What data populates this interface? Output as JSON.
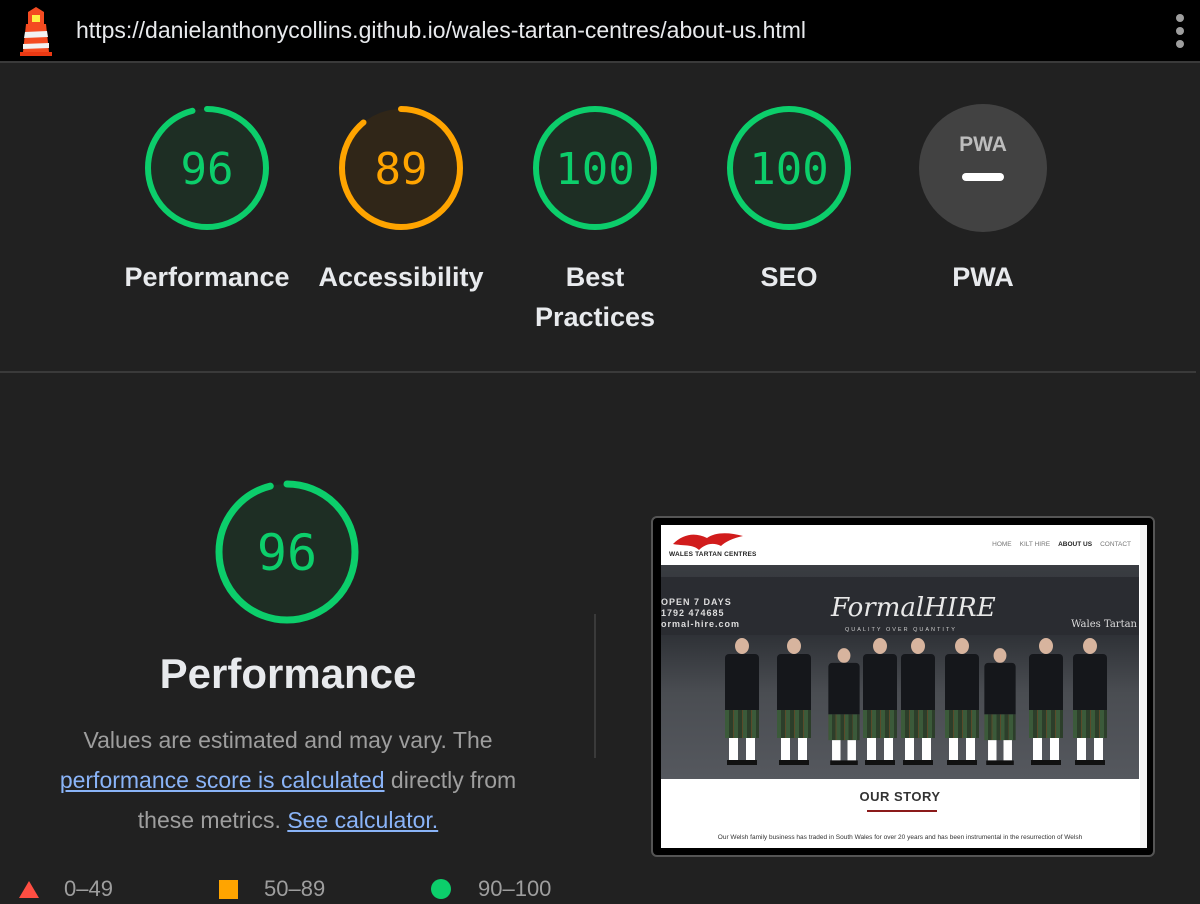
{
  "topbar": {
    "url": "https://danielanthonycollins.github.io/wales-tartan-centres/about-us.html",
    "logo_icon": "lighthouse-icon",
    "menu_icon": "kebab-menu-icon"
  },
  "gauges": [
    {
      "score": "96",
      "label": "Performance",
      "color": "#0cce6b",
      "fraction": 0.96
    },
    {
      "score": "89",
      "label": "Accessibility",
      "color": "#ffa400",
      "fraction": 0.89
    },
    {
      "score": "100",
      "label_line1": "Best",
      "label_line2": "Practices",
      "color": "#0cce6b",
      "fraction": 1.0
    },
    {
      "score": "100",
      "label": "SEO",
      "color": "#0cce6b",
      "fraction": 1.0
    },
    {
      "badge": "PWA",
      "label": "PWA",
      "color": "#9e9e9e"
    }
  ],
  "performance": {
    "score": "96",
    "fraction": 0.96,
    "title": "Performance",
    "desc_part1": "Values are estimated and may vary. The",
    "link1": "performance score is calculated",
    "desc_part2": "directly from these metrics.",
    "link2": "See calculator."
  },
  "legend": [
    {
      "range": "0–49",
      "shape": "triangle",
      "color": "#ff4e42"
    },
    {
      "range": "50–89",
      "shape": "square",
      "color": "#ffa400"
    },
    {
      "range": "90–100",
      "shape": "circle",
      "color": "#0cce6b"
    }
  ],
  "screenshot": {
    "brand": "WALES TARTAN CENTRES",
    "nav": [
      "HOME",
      "KILT HIRE",
      "ABOUT US",
      "CONTACT"
    ],
    "banner_open": "OPEN 7 DAYS",
    "banner_phone": "1792 474685",
    "banner_site": "ormal-hire.com",
    "banner_formal": "FormalHIRE",
    "banner_sub": "QUALITY OVER QUANTITY",
    "banner_tartan": "Wales Tartan",
    "heading": "OUR STORY",
    "text": "Our Welsh family business has traded in South Wales for over 20 years and has been instrumental in the resurrection of Welsh"
  }
}
